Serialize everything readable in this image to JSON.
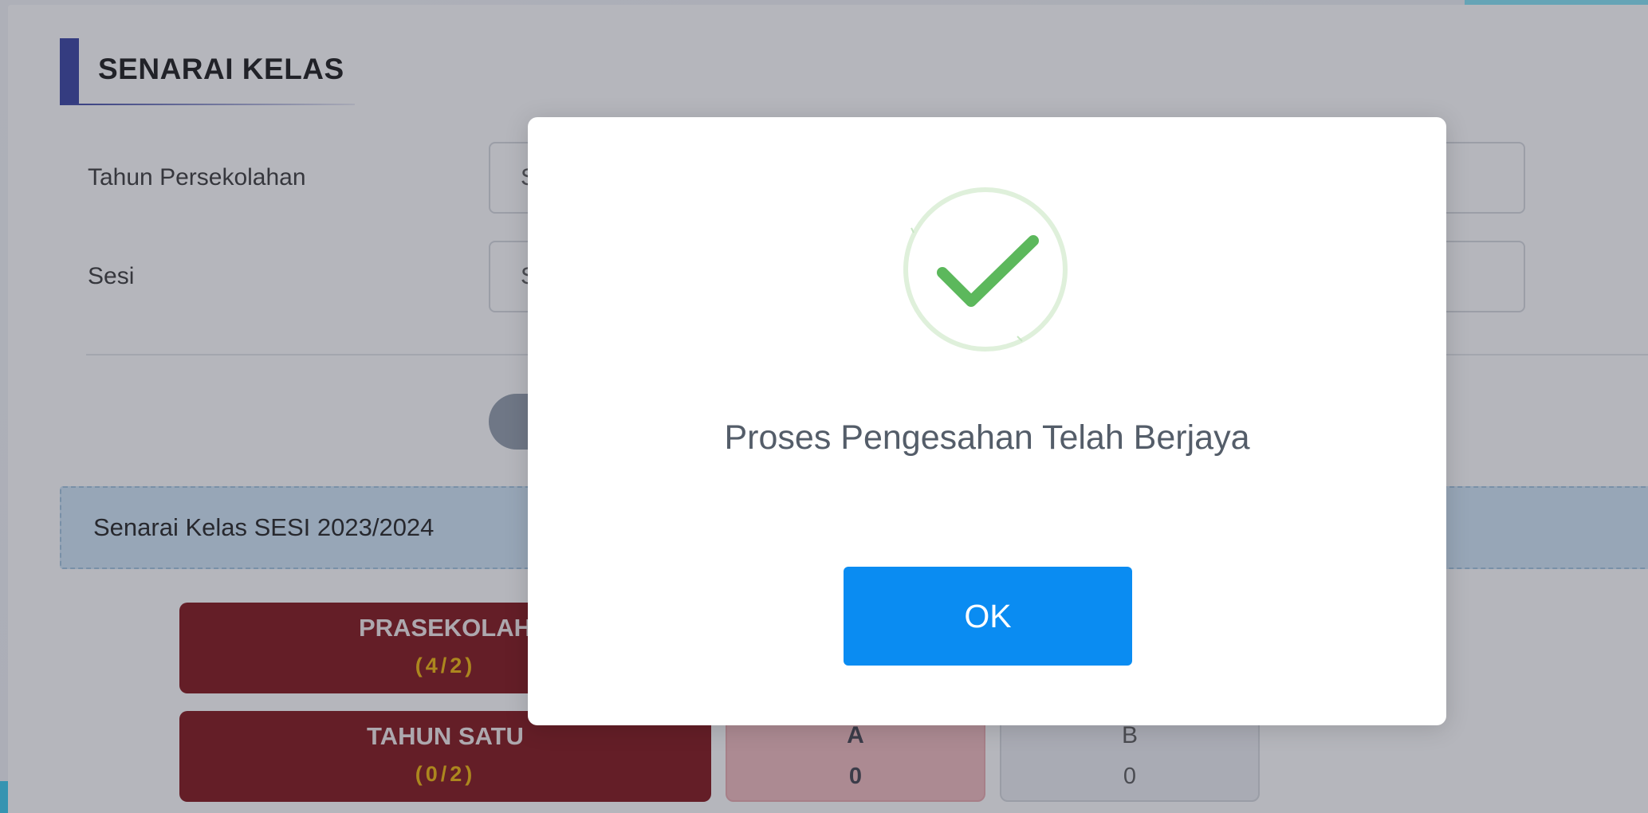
{
  "page": {
    "title": "SENARAI KELAS"
  },
  "form": {
    "year_label": "Tahun Persekolahan",
    "year_value": "S",
    "session_label": "Sesi",
    "session_value": "S"
  },
  "session_banner": {
    "text": "Senarai Kelas SESI 2023/2024"
  },
  "classes": [
    {
      "name": "PRASEKOLAH",
      "count": "(4/2)"
    },
    {
      "name": "TAHUN SATU",
      "count": "(0/2)"
    }
  ],
  "sub_classes": [
    {
      "label": "A",
      "value": "0"
    },
    {
      "label": "B",
      "value": "0"
    }
  ],
  "modal": {
    "message": "Proses Pengesahan Telah Berjaya",
    "ok_label": "OK",
    "icon": "check-icon"
  },
  "colors": {
    "primary": "#0a8cf2",
    "success": "#5cb85c",
    "class_card": "#7c0a10",
    "title_accent": "#2f3a9e"
  }
}
